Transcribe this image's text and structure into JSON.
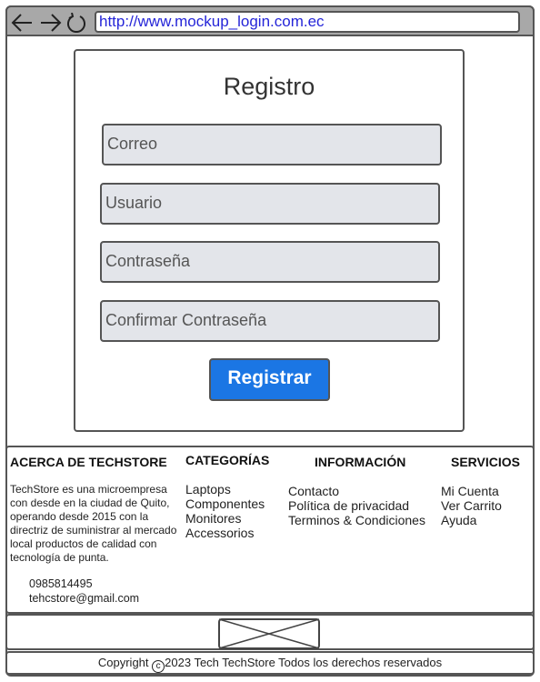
{
  "browser": {
    "url": "http://www.mockup_login.com.ec"
  },
  "form": {
    "title": "Registro",
    "fields": [
      {
        "placeholder": "Correo"
      },
      {
        "placeholder": "Usuario"
      },
      {
        "placeholder": "Contraseña"
      },
      {
        "placeholder": "Confirmar Contraseña"
      }
    ],
    "submit_label": "Registrar"
  },
  "footer": {
    "about": {
      "heading": "ACERCA DE TECHSTORE",
      "text": "TechStore es una microempresa con desde en la ciudad de Quito, operando desde 2015 con la directriz de suministrar al mercado local productos de calidad con tecnología de punta.",
      "phone": "0985814495",
      "email": "tehcstore@gmail.com"
    },
    "categories": {
      "heading": "CATEGORÍAS",
      "items": [
        "Laptops",
        "Componentes",
        "Monitores",
        "Accessorios"
      ]
    },
    "info": {
      "heading": "INFORMACIÓN",
      "items": [
        "Contacto",
        "Política de privacidad",
        "Terminos & Condiciones"
      ]
    },
    "services": {
      "heading": "SERVICIOS",
      "items": [
        "Mi Cuenta",
        "Ver Carrito",
        "Ayuda"
      ]
    }
  },
  "copyright": {
    "symbol": "c",
    "text": "2023 Tech TechStore Todos los derechos reservados",
    "prefix": "Copyright"
  },
  "colors": {
    "accent": "#1b76e4",
    "field_bg": "#e3e5ea",
    "browser_bar": "#a8a8a8",
    "url_text": "#2525d8"
  }
}
